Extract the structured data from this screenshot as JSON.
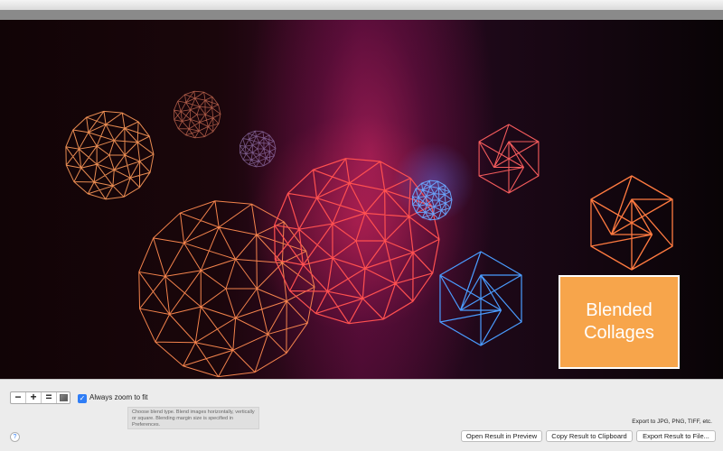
{
  "canvas": {
    "label_line1": "Blended",
    "label_line2": "Collages",
    "label_color": "#f7a54b",
    "shapes": [
      "geodesic-sphere",
      "geodesic-sphere",
      "geodesic-sphere",
      "geodesic-sphere",
      "geodesic-sphere",
      "geodesic-sphere",
      "icosahedron",
      "icosahedron",
      "icosahedron"
    ]
  },
  "toolbar": {
    "zoom_out_label": "−",
    "zoom_in_label": "+",
    "actual_size_label": "=",
    "always_zoom_label": "Always zoom to fit",
    "always_zoom_checked": true
  },
  "tooltip": {
    "text": "Choose blend type. Blend images horizontally, vertically or square. Blending margin size is specified in Preferences."
  },
  "export": {
    "note": "Export to JPG, PNG, TIFF, etc.",
    "open_preview_label": "Open Result in Preview",
    "copy_clipboard_label": "Copy Result to Clipboard",
    "export_file_label": "Export Result to File..."
  },
  "help": {
    "label": "?"
  },
  "colors": {
    "accent": "#2f7df6",
    "red_wire": "#ff4d4d",
    "orange_wire": "#ff8a4a",
    "blue_wire": "#4aa3ff"
  }
}
